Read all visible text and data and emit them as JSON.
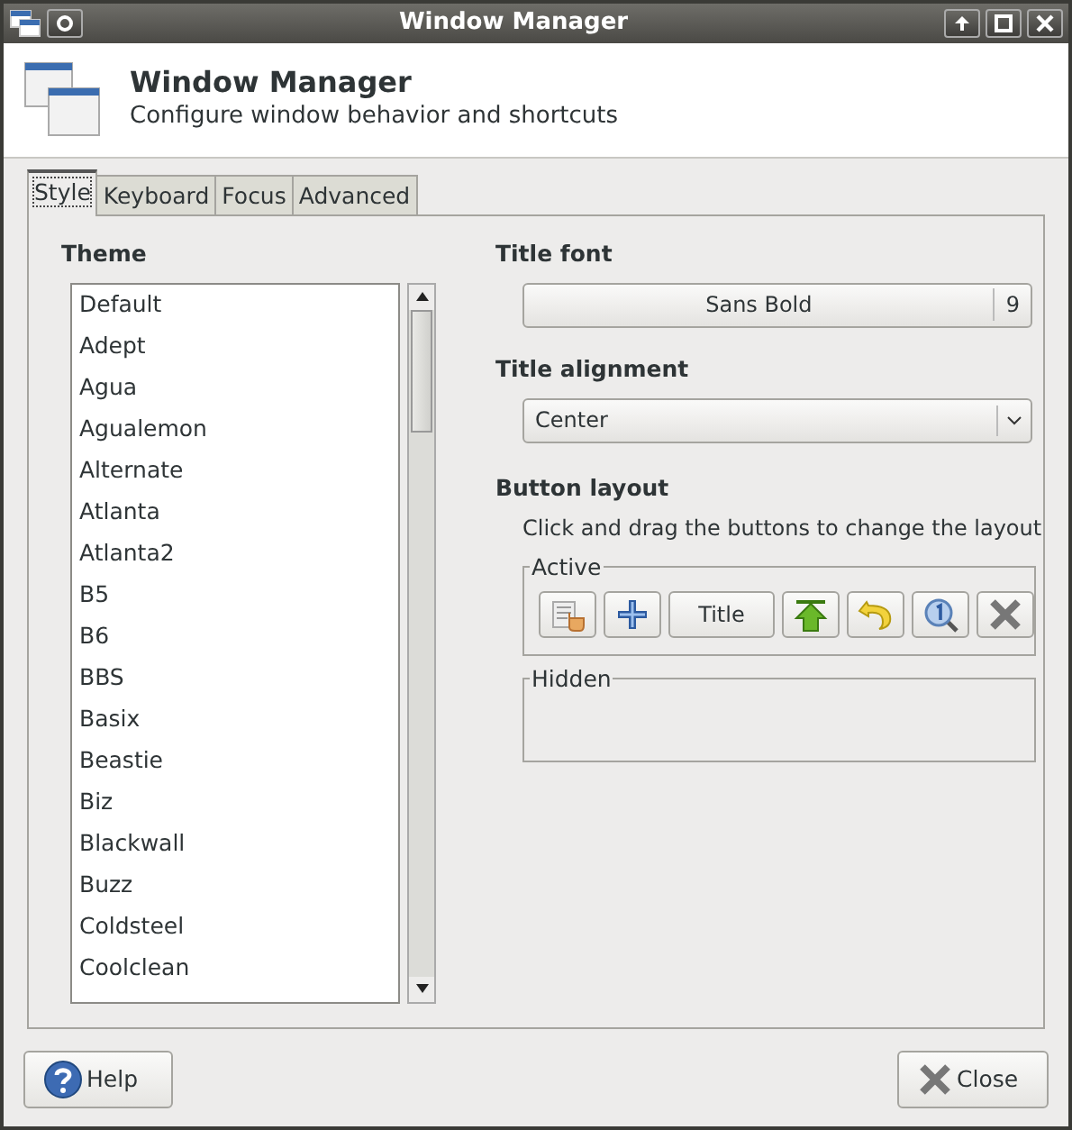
{
  "window": {
    "title": "Window Manager"
  },
  "header": {
    "title": "Window Manager",
    "subtitle": "Configure window behavior and shortcuts"
  },
  "tabs": [
    {
      "label": "Style",
      "selected": true
    },
    {
      "label": "Keyboard",
      "selected": false
    },
    {
      "label": "Focus",
      "selected": false
    },
    {
      "label": "Advanced",
      "selected": false
    }
  ],
  "theme": {
    "label": "Theme",
    "items": [
      {
        "label": "Default",
        "selected": false
      },
      {
        "label": "Adept",
        "selected": false
      },
      {
        "label": "Agua",
        "selected": false
      },
      {
        "label": "Agualemon",
        "selected": false
      },
      {
        "label": "Alternate",
        "selected": false
      },
      {
        "label": "Atlanta",
        "selected": false
      },
      {
        "label": "Atlanta2",
        "selected": false
      },
      {
        "label": "B5",
        "selected": false
      },
      {
        "label": "B6",
        "selected": false
      },
      {
        "label": "BBS",
        "selected": false
      },
      {
        "label": "Basix",
        "selected": false
      },
      {
        "label": "Beastie",
        "selected": false
      },
      {
        "label": "Biz",
        "selected": false
      },
      {
        "label": "Blackwall",
        "selected": false
      },
      {
        "label": "Buzz",
        "selected": false
      },
      {
        "label": "Coldsteel",
        "selected": false
      },
      {
        "label": "Coolclean",
        "selected": false
      }
    ]
  },
  "title_font": {
    "label": "Title font",
    "font": "Sans Bold",
    "size": "9"
  },
  "title_alignment": {
    "label": "Title alignment",
    "value": "Center"
  },
  "button_layout": {
    "label": "Button layout",
    "hint": "Click and drag the buttons to change the layout",
    "active": {
      "label": "Active",
      "buttons": [
        {
          "kind": "menu"
        },
        {
          "kind": "stick"
        },
        {
          "kind": "title",
          "label": "Title"
        },
        {
          "kind": "shade"
        },
        {
          "kind": "hide"
        },
        {
          "kind": "maximize"
        },
        {
          "kind": "close"
        }
      ]
    },
    "hidden": {
      "label": "Hidden"
    }
  },
  "footer": {
    "help": "Help",
    "close": "Close"
  }
}
